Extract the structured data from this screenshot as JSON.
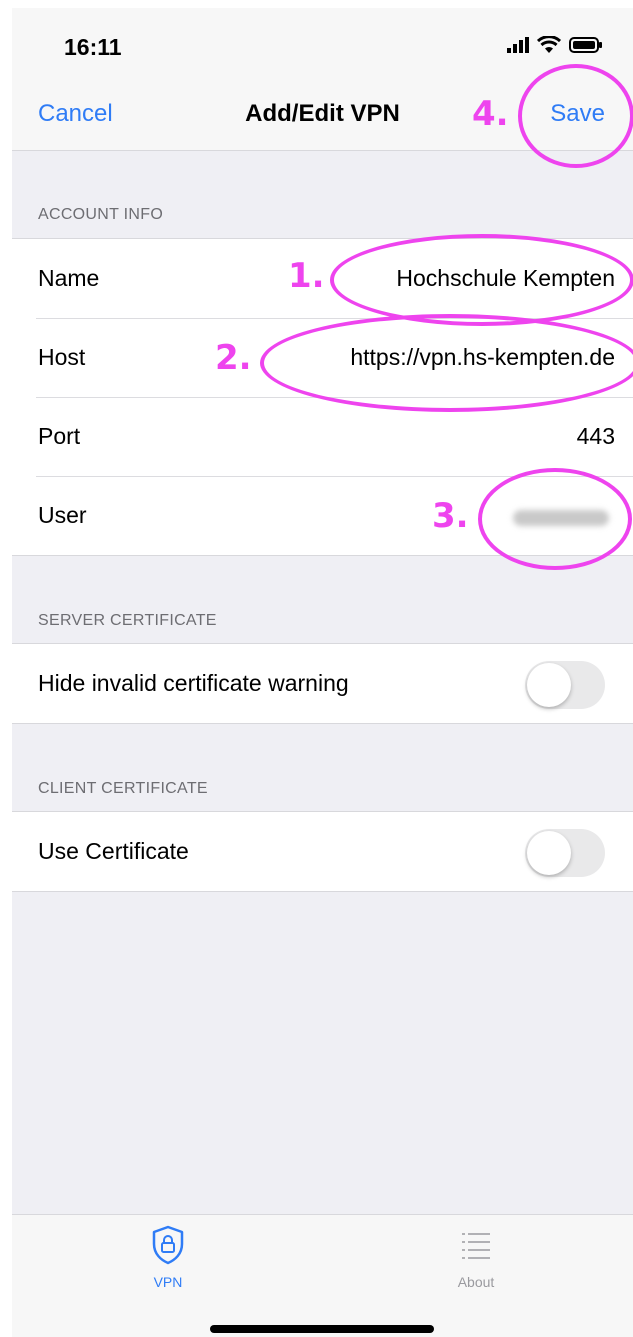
{
  "status_bar": {
    "time": "16:11"
  },
  "nav": {
    "cancel_label": "Cancel",
    "title": "Add/Edit VPN",
    "save_label": "Save"
  },
  "account_info": {
    "header": "ACCOUNT INFO",
    "rows": [
      {
        "label": "Name",
        "value": "Hochschule Kempten"
      },
      {
        "label": "Host",
        "value": "https://vpn.hs-kempten.de"
      },
      {
        "label": "Port",
        "value": "443"
      },
      {
        "label": "User"
      }
    ]
  },
  "server_certificate": {
    "header": "SERVER CERTIFICATE",
    "rows": [
      {
        "label": "Hide invalid certificate warning",
        "toggle_on": false
      }
    ]
  },
  "client_certificate": {
    "header": "CLIENT CERTIFICATE",
    "rows": [
      {
        "label": "Use Certificate",
        "toggle_on": false
      }
    ]
  },
  "annotations": [
    "1.",
    "2.",
    "3.",
    "4."
  ],
  "tabs": [
    {
      "label": "VPN",
      "icon": "shield-lock-icon",
      "active": true
    },
    {
      "label": "About",
      "icon": "list-icon",
      "active": false
    }
  ],
  "colors": {
    "accent": "#2f7cf6",
    "annotation": "#ee44ee",
    "toggle_off": "#e9e9ea"
  }
}
